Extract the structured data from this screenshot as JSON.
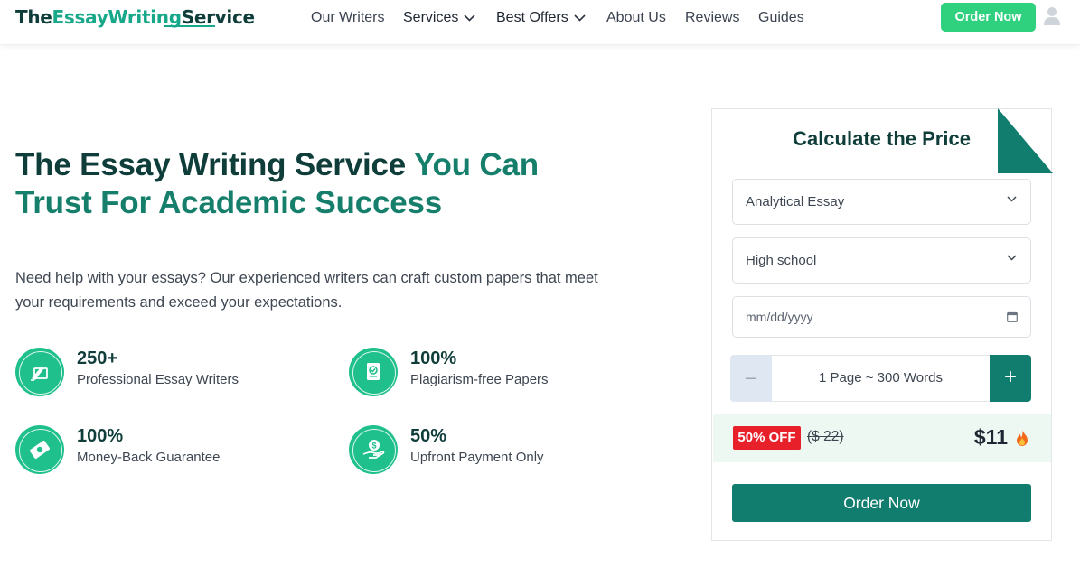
{
  "header": {
    "logo": {
      "part1": "The",
      "part2": "EssayWriting",
      "part3": "Service"
    },
    "nav": [
      {
        "label": "Our Writers"
      },
      {
        "label": "Services"
      },
      {
        "label": "Best Offers"
      },
      {
        "label": "About Us"
      },
      {
        "label": "Reviews"
      },
      {
        "label": "Guides"
      }
    ],
    "order_button": "Order Now",
    "icons": {
      "dropdown": "chevron-down-icon",
      "user": "user-icon"
    }
  },
  "hero": {
    "title_dark": "The Essay Writing Service ",
    "title_green": "You Can Trust For Academic Success",
    "description": "Need help with your essays? Our experienced writers can craft custom papers that meet your requirements and exceed your expectations.",
    "features": [
      {
        "number": "250+",
        "label": "Professional Essay Writers",
        "icon": "writer-pen-icon"
      },
      {
        "number": "100%",
        "label": "Plagiarism-free Papers",
        "icon": "document-check-icon"
      },
      {
        "number": "100%",
        "label": "Money-Back Guarantee",
        "icon": "money-back-icon"
      },
      {
        "number": "50%",
        "label": "Upfront Payment Only",
        "icon": "hand-coin-icon"
      }
    ]
  },
  "calculator": {
    "title": "Calculate the Price",
    "paper_type": "Analytical Essay",
    "academic_level": "High school",
    "deadline_placeholder": "mm/dd/yyyy",
    "pages_label": "1 Page ~ 300 Words",
    "minus": "–",
    "plus": "+",
    "discount_badge": "50% OFF",
    "old_price": "($ 22)",
    "new_price": "$11",
    "order_button": "Order Now",
    "colors": {
      "accent": "#117d6e",
      "badge": "#e8202a",
      "cta_header": "#2fd17e"
    }
  }
}
